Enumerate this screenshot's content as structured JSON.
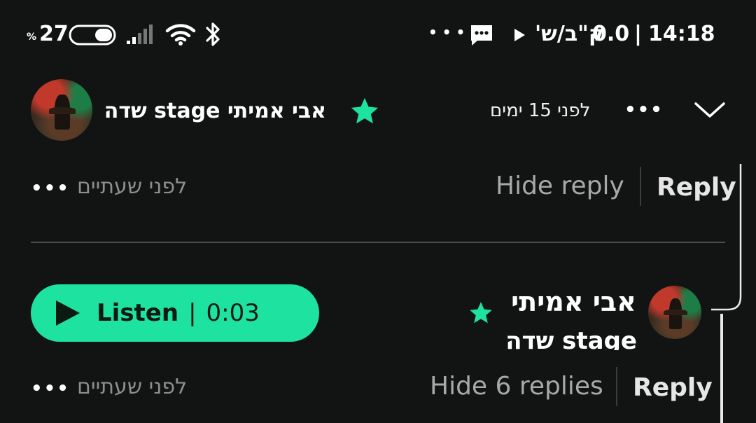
{
  "status_bar": {
    "battery_percent_symbol": "%",
    "battery_level": "27",
    "time": "14:18",
    "separator": "|",
    "data_rate": "0.0",
    "data_unit": "ק\"ב/ש'",
    "overflow": "• • •",
    "icons": [
      "battery-icon",
      "signal-icon",
      "wifi-icon",
      "bluetooth-icon",
      "message-icon",
      "play-icon"
    ]
  },
  "post_header": {
    "author_line": "אבי אמיתי stage שדה",
    "time_ago": "לפני 15 ימים",
    "more": "•••"
  },
  "reply_actions_1": {
    "time_ago": "לפני שעתיים",
    "more": "•••",
    "hide_reply": "Hide reply",
    "reply": "Reply"
  },
  "comment": {
    "author_name": "אבי אמיתי",
    "author_sub": "stage שדה",
    "listen_label": "Listen",
    "listen_separator": "|",
    "duration": "0:03"
  },
  "reply_actions_2": {
    "time_ago": "לפני שעתיים",
    "more": "•••",
    "hide_replies": "Hide 6 replies",
    "reply": "Reply"
  },
  "colors": {
    "background": "#121414",
    "accent": "#1ee3a0",
    "muted_text": "#9c9c9c"
  }
}
